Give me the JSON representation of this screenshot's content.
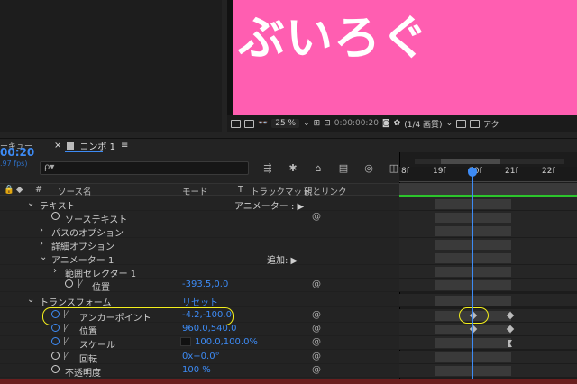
{
  "viewer": {
    "text": "ぶいろぐ",
    "zoom": "25 %",
    "timecode": "0:00:00:20",
    "resolution": "(1/4 画質)",
    "active_label": "アク"
  },
  "panel": {
    "left_tab": "ーキュー",
    "comp_tab": "コンポ 1",
    "timecode": "00:20",
    "fps": ".97 fps)",
    "search_placeholder": "ρ▾"
  },
  "columns": {
    "source_name": "ソース名",
    "mode": "モード",
    "t": "T",
    "trackmatte": "トラックマット",
    "parent": "親とリンク",
    "hash": "#"
  },
  "rows": [
    {
      "label": "テキスト",
      "mode": "アニメーター : ▶"
    },
    {
      "label": "ソーステキスト"
    },
    {
      "label": "パスのオプション"
    },
    {
      "label": "詳細オプション"
    },
    {
      "label": "アニメーター 1",
      "mode": "追加: ▶"
    },
    {
      "label": "範囲セレクター 1"
    },
    {
      "label": "位置",
      "value": "-393.5,0.0"
    },
    {
      "label": "トランスフォーム",
      "value": "リセット"
    },
    {
      "label": "アンカーポイント",
      "value": "-4.2,-100.0"
    },
    {
      "label": "位置",
      "value": "960.0,540.0"
    },
    {
      "label": "スケール",
      "value": "100.0,100.0%"
    },
    {
      "label": "回転",
      "value": "0x+0.0°"
    },
    {
      "label": "不透明度",
      "value": "100 %"
    }
  ],
  "timeline": {
    "ticks": [
      "8f",
      "19f",
      "20f",
      "21f",
      "22f"
    ]
  },
  "colors": {
    "viewer_bg": "#ff5eb1",
    "accent": "#3d8bf5",
    "highlight": "#f3ef1c",
    "green": "#2cc52c"
  }
}
